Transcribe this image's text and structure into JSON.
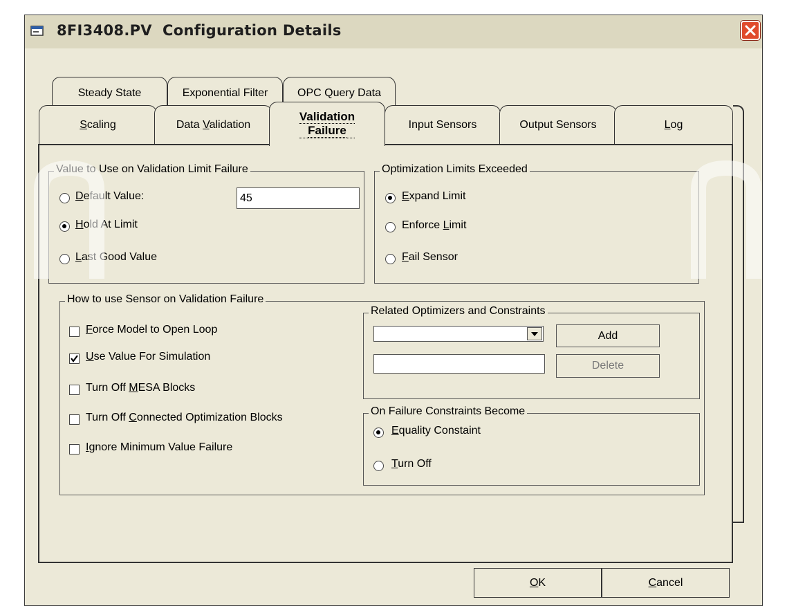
{
  "window": {
    "title": "8FI3408.PV  Configuration Details",
    "close_glyph": "✕",
    "icon": "app-icon"
  },
  "tabs_row1": [
    {
      "label": "Steady State"
    },
    {
      "label": "Exponential Filter"
    },
    {
      "label": "OPC Query Data"
    }
  ],
  "tabs_row2": [
    {
      "label": "Scaling",
      "underline": "S",
      "rest": "caling"
    },
    {
      "label": "Data Validation",
      "pre": "Data ",
      "underline": "V",
      "rest": "alidation"
    },
    {
      "label": "Validation Failure",
      "line1": "Validation",
      "line2": "Failure",
      "active": true
    },
    {
      "label": "Input Sensors"
    },
    {
      "label": "Output Sensors"
    },
    {
      "label": "Log",
      "underline": "L",
      "rest": "og"
    }
  ],
  "value_group": {
    "title": "Value to Use on Validation Limit Failure",
    "options": [
      {
        "u": "D",
        "rest": "efault Value:",
        "selected": false
      },
      {
        "u": "H",
        "rest": "old At Limit",
        "selected": true
      },
      {
        "u": "L",
        "rest": "ast Good Value",
        "selected": false
      }
    ],
    "default_value": "45"
  },
  "opt_group": {
    "title": "Optimization Limits Exceeded",
    "options": [
      {
        "pre": "",
        "u": "E",
        "rest": "xpand Limit",
        "selected": true
      },
      {
        "pre": "Enforce ",
        "u": "L",
        "rest": "imit",
        "selected": false
      },
      {
        "pre": "",
        "u": "F",
        "rest": "ail Sensor",
        "selected": false
      }
    ]
  },
  "sensor_group": {
    "title": "How to use Sensor on Validation Failure",
    "options": [
      {
        "pre": "",
        "u": "F",
        "rest": "orce Model to Open Loop",
        "checked": false
      },
      {
        "pre": "",
        "u": "U",
        "rest": "se Value For Simulation",
        "checked": true
      },
      {
        "pre": "Turn Off ",
        "u": "M",
        "rest": "ESA Blocks",
        "checked": false
      },
      {
        "pre": "Turn Off ",
        "u": "C",
        "rest": "onnected Optimization Blocks",
        "checked": false
      },
      {
        "pre": "",
        "u": "I",
        "rest": "gnore Minimum Value Failure",
        "checked": false
      }
    ]
  },
  "related_group": {
    "title": "Related Optimizers and Constraints",
    "combo_value": "",
    "text_value": "",
    "add_label": "Add",
    "delete_label": "Delete"
  },
  "failure_group": {
    "title": "On Failure Constraints Become",
    "options": [
      {
        "u": "E",
        "rest": "quality Constaint",
        "selected": true
      },
      {
        "u": "T",
        "rest": "urn Off",
        "selected": false
      }
    ]
  },
  "buttons": {
    "ok_u": "O",
    "ok_rest": "K",
    "cancel_u": "C",
    "cancel_rest": "ancel"
  },
  "colors": {
    "dialog_bg": "#ece9d8",
    "close_red": "#e04a2c"
  }
}
